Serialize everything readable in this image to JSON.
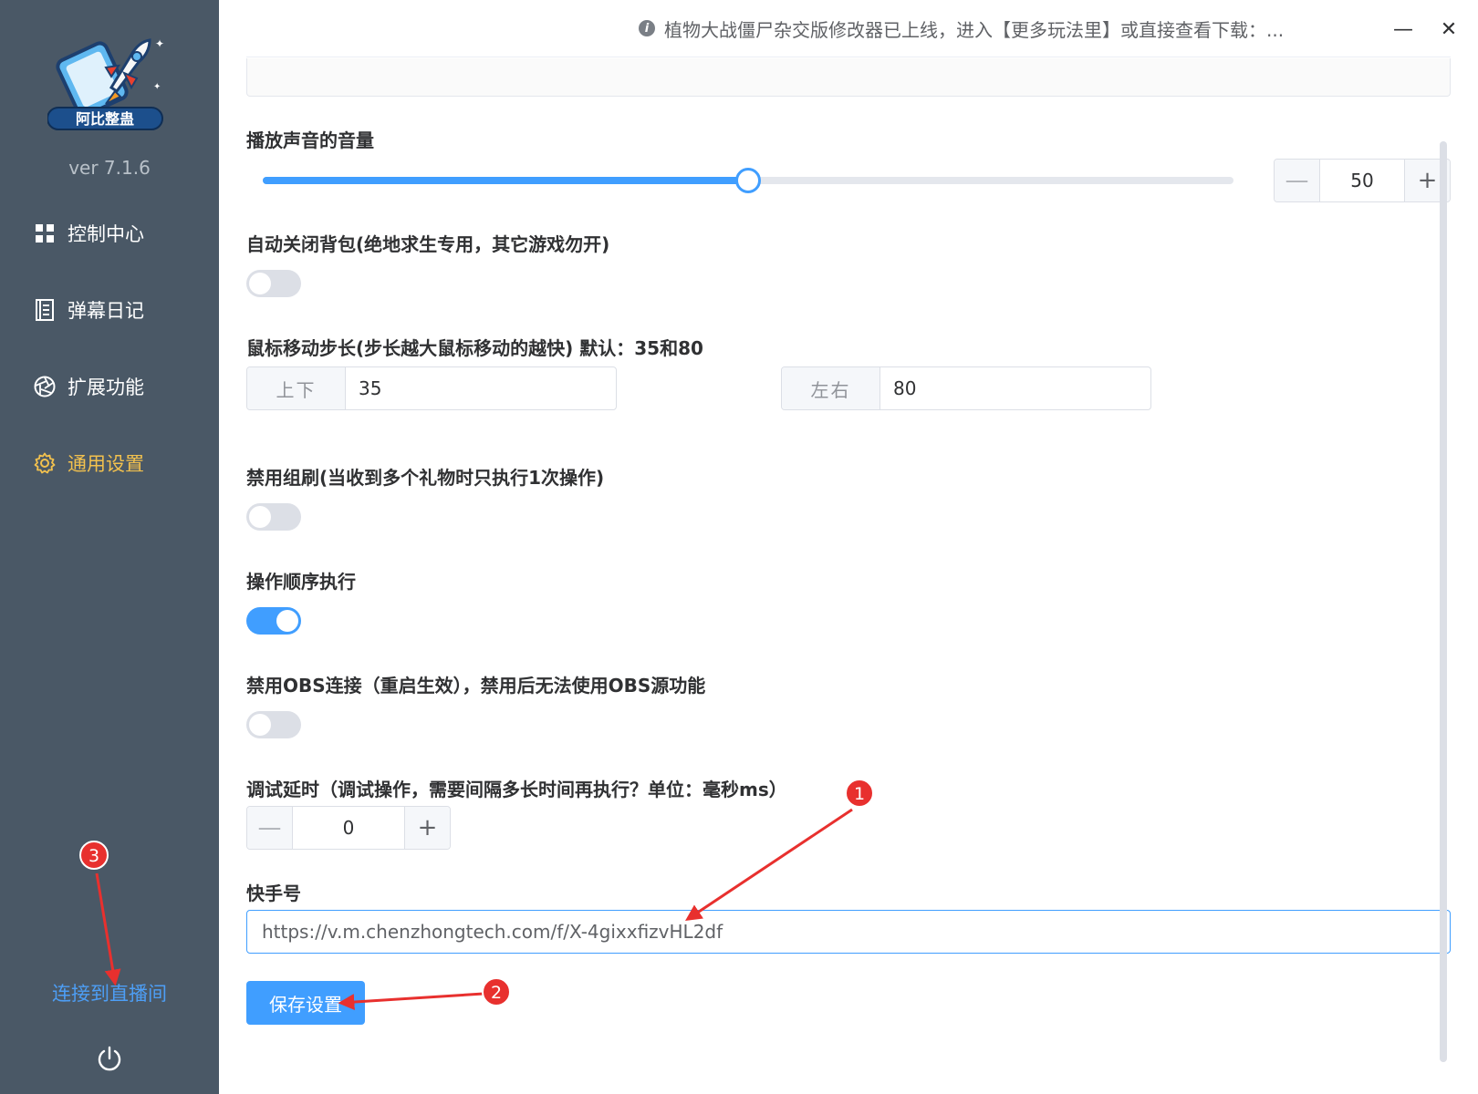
{
  "sidebar": {
    "logo_text": "阿比整蛊",
    "version": "ver 7.1.6",
    "items": [
      {
        "label": "控制中心",
        "icon": "grid-icon",
        "active": false
      },
      {
        "label": "弹幕日记",
        "icon": "notebook-icon",
        "active": false
      },
      {
        "label": "扩展功能",
        "icon": "aperture-icon",
        "active": false
      },
      {
        "label": "通用设置",
        "icon": "gear-icon",
        "active": true
      }
    ],
    "connect_label": "连接到直播间",
    "power_icon": "power-icon"
  },
  "titlebar": {
    "notice": "植物大战僵尸杂交版修改器已上线，进入【更多玩法里】或直接查看下载：...",
    "minimize_label": "—",
    "close_label": "✕"
  },
  "settings": {
    "volume": {
      "label": "播放声音的音量",
      "value": "50",
      "level": 0.5,
      "minus": "—",
      "plus": "+"
    },
    "auto_close_bag": {
      "label": "自动关闭背包(绝地求生专用，其它游戏勿开)",
      "enabled": false
    },
    "mouse_step": {
      "label": "鼠标移动步长(步长越大鼠标移动的越快) 默认：35和80",
      "vertical": {
        "prepend": "上下",
        "value": "35"
      },
      "horizontal": {
        "prepend": "左右",
        "value": "80"
      }
    },
    "disable_group": {
      "label": "禁用组刷(当收到多个礼物时只执行1次操作)",
      "enabled": false
    },
    "sequential": {
      "label": "操作顺序执行",
      "enabled": true
    },
    "disable_obs": {
      "label": "禁用OBS连接（重启生效），禁用后无法使用OBS源功能",
      "enabled": false
    },
    "debug_delay": {
      "label": "调试延时（调试操作，需要间隔多长时间再执行？单位：毫秒ms）",
      "value": "0",
      "minus": "—",
      "plus": "+"
    },
    "kuaishou": {
      "label": "快手号",
      "value": "https://v.m.chenzhongtech.com/f/X-4gixxfizvHL2df"
    },
    "save_label": "保存设置"
  },
  "annotations": {
    "markers": [
      "1",
      "2",
      "3"
    ],
    "color": "#e8302e"
  },
  "colors": {
    "sidebar_bg": "#4a5866",
    "accent": "#409eff",
    "active_nav": "#f2c14e"
  }
}
